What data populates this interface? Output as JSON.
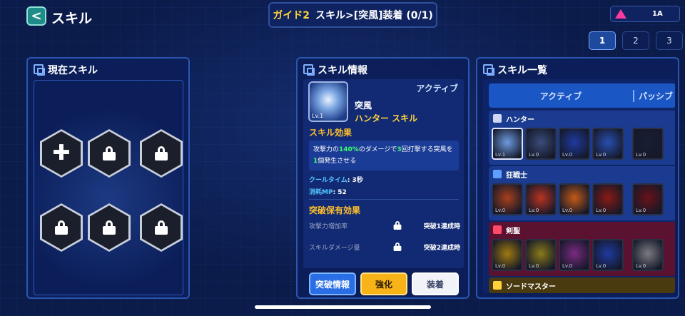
{
  "header": {
    "back_label": "<",
    "title": "スキル",
    "guide_prefix": "ガイド2",
    "guide_text": "スキル>[突風]装着 (0/1)",
    "resource_value": "1A",
    "resource_icon": "pink-triangle-icon"
  },
  "page_tabs": [
    "1",
    "2",
    "3"
  ],
  "current_skills": {
    "title": "現在スキル",
    "slots": [
      "add",
      "locked",
      "locked",
      "locked",
      "locked",
      "locked"
    ]
  },
  "skill_info": {
    "title": "スキル情報",
    "icon_level": "Lv.1",
    "kind": "アクティブ",
    "name": "突風",
    "type": "ハンター スキル",
    "effect_title": "スキル効果",
    "effect_parts": [
      "攻撃力の",
      "140%",
      "のダメージで",
      "3",
      "回打撃する突風を",
      "1",
      "個発生させる"
    ],
    "cooltime_label": "クールタイム",
    "cooltime_value": ": 3秒",
    "mp_label": "消耗MP",
    "mp_value": ": 52",
    "break_title": "突破保有効果",
    "break_rows": [
      {
        "name": "攻撃力増加率",
        "cond": "突破1達成時"
      },
      {
        "name": "スキルダメージ量",
        "cond": "突破2達成時"
      }
    ],
    "buttons": {
      "break": "突破情報",
      "upgrade": "強化",
      "equip": "装着"
    }
  },
  "skill_list": {
    "title": "スキル一覧",
    "tabs": [
      "アクティブ",
      "パッシブ"
    ],
    "groups": [
      {
        "name": "ハンター",
        "color": "#1a3b8f",
        "icon_color": "#cfd8f0",
        "thumbs": [
          "Lv.1",
          "Lv.0",
          "Lv.0",
          "Lv.0",
          "Lv.0"
        ],
        "thumb_colors": [
          "#6f9be0",
          "#3a4c7a",
          "#1f3aa0",
          "#2a4fb0",
          "#1a1e34"
        ]
      },
      {
        "name": "狂戦士",
        "color": "#1a3b8f",
        "icon_color": "#5fa0ff",
        "thumbs": [
          "Lv.0",
          "Lv.0",
          "Lv.0",
          "Lv.0",
          "Lv.0"
        ],
        "thumb_colors": [
          "#a8401c",
          "#b83420",
          "#c45a18",
          "#8a1a14",
          "#6a1218"
        ]
      },
      {
        "name": "剣聖",
        "color": "#5a1230",
        "icon_color": "#ff4a6a",
        "thumbs": [
          "Lv.0",
          "Lv.0",
          "Lv.0",
          "Lv.0",
          "Lv.0"
        ],
        "thumb_colors": [
          "#a07a10",
          "#8a7a18",
          "#7a2a80",
          "#1f3aa0",
          "#7a7a80"
        ]
      },
      {
        "name": "ソードマスター",
        "color": "#4a3a10",
        "icon_color": "#ffd23a",
        "thumbs": [],
        "thumb_colors": []
      }
    ]
  }
}
